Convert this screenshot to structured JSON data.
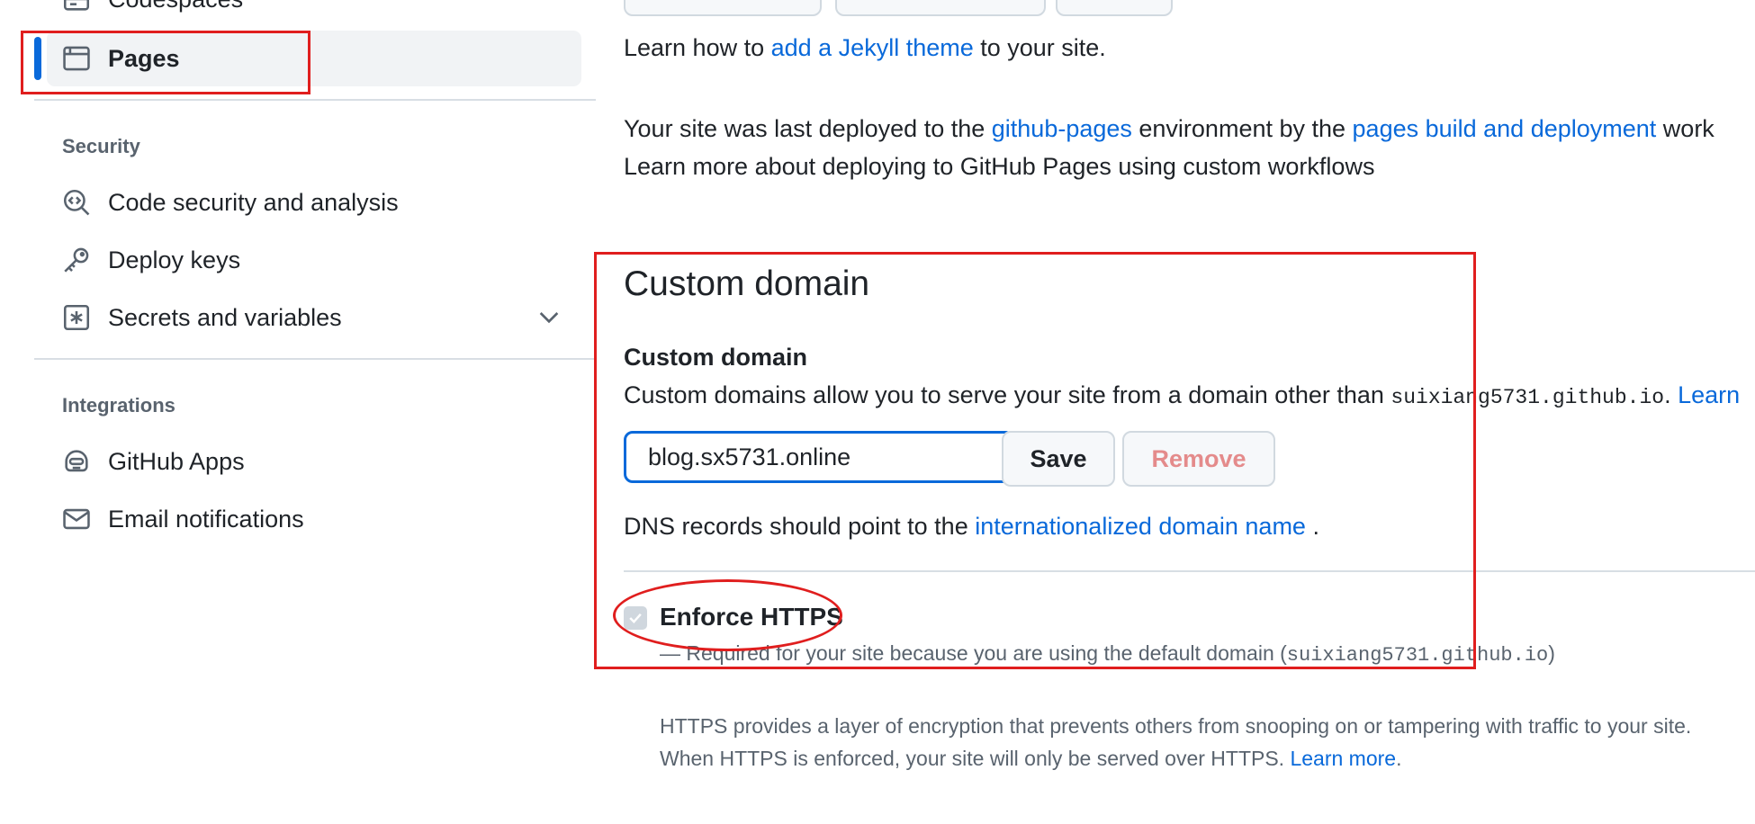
{
  "sidebar": {
    "codespaces": {
      "label": "Codespaces",
      "icon": "server-icon"
    },
    "pages": {
      "label": "Pages",
      "icon": "browser-icon"
    },
    "security_section": "Security",
    "security_items": [
      {
        "label": "Code security and analysis",
        "icon": "codescan-icon"
      },
      {
        "label": "Deploy keys",
        "icon": "key-icon"
      },
      {
        "label": "Secrets and variables",
        "icon": "asterisk-icon"
      }
    ],
    "integrations_section": "Integrations",
    "integrations_items": [
      {
        "label": "GitHub Apps",
        "icon": "hubot-icon"
      },
      {
        "label": "Email notifications",
        "icon": "mail-icon"
      }
    ]
  },
  "theme": {
    "line_prefix": "Learn how to ",
    "link": "add a Jekyll theme",
    "line_suffix": " to your site."
  },
  "deploy": {
    "prefix": "Your site was last deployed to the ",
    "env_link": "github-pages",
    "middle": " environment by the ",
    "workflow_link": "pages build and deployment",
    "suffix": " work",
    "learn_link": "Learn more about deploying to GitHub Pages using custom workflows"
  },
  "custom_domain": {
    "heading": "Custom domain",
    "label": "Custom domain",
    "desc_prefix": "Custom domains allow you to serve your site from a domain other than ",
    "default_domain": "suixiang5731.github.io",
    "desc_suffix": ". ",
    "desc_link": "Learn",
    "input_value": "blog.sx5731.online",
    "save_label": "Save",
    "remove_label": "Remove",
    "dns_prefix": "DNS records should point to the ",
    "dns_link": "internationalized domain name",
    "dns_suffix": " ."
  },
  "https": {
    "label": "Enforce HTTPS",
    "checked": true,
    "note_prefix": "— Required for your site because you are using the default domain (",
    "note_domain": "suixiang5731.github.io",
    "note_suffix": ")",
    "para1": "HTTPS provides a layer of encryption that prevents others from snooping on or tampering with traffic to your site.",
    "para2_prefix": "When HTTPS is enforced, your site will only be served over HTTPS. ",
    "para2_link": "Learn more",
    "para2_suffix": "."
  },
  "colors": {
    "accent": "#0969da",
    "annotation": "#e01e1e",
    "remove_text": "#e48b8b"
  }
}
